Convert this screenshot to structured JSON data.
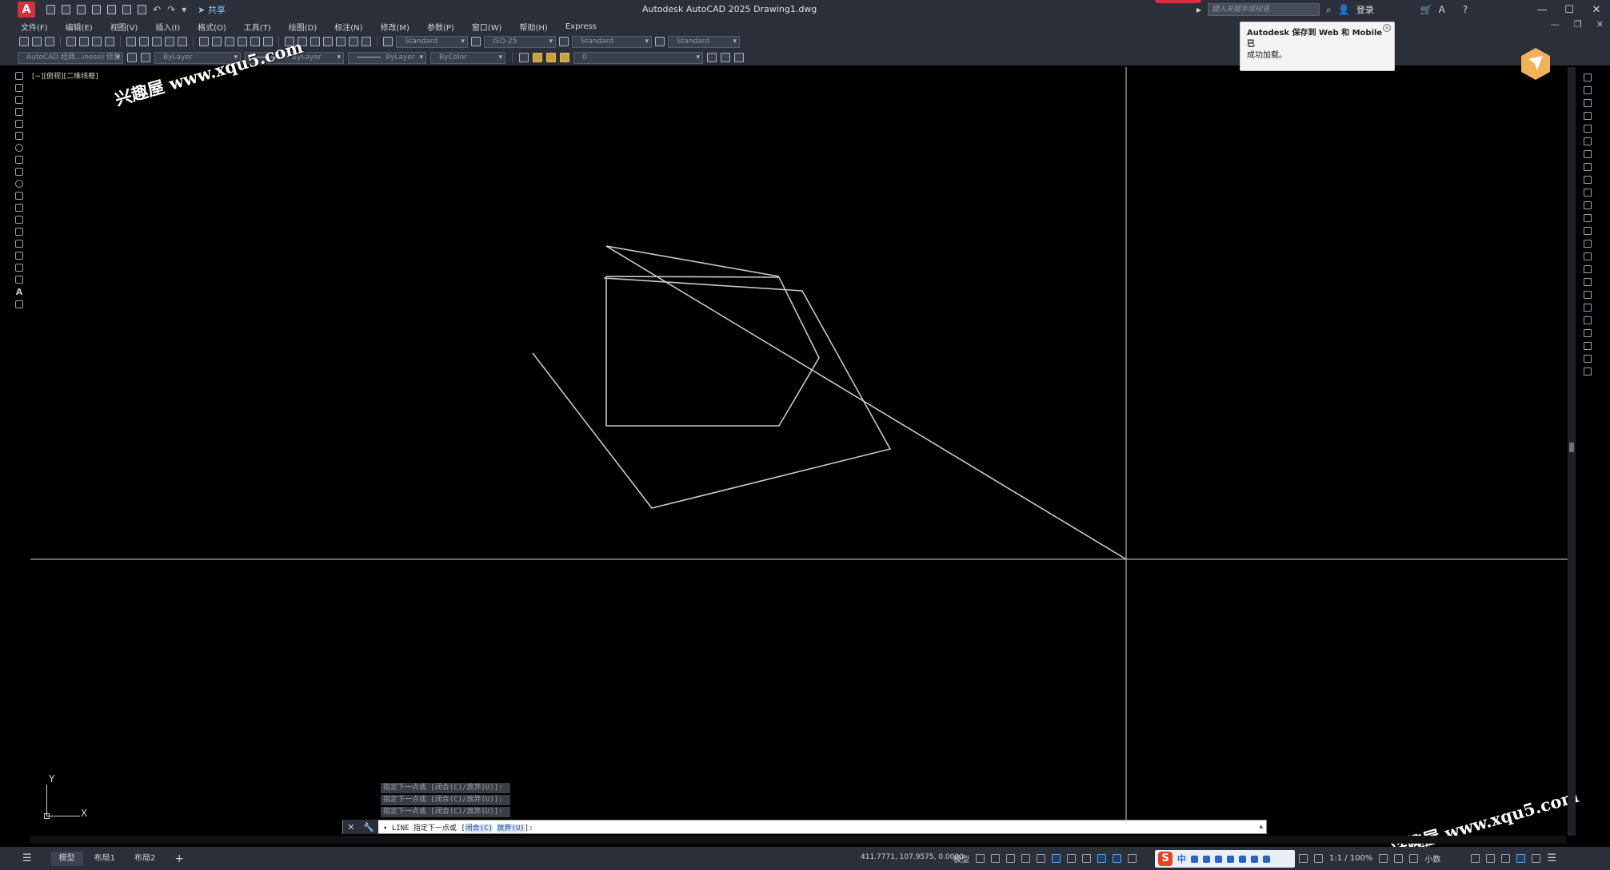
{
  "app": {
    "logo_letter": "A",
    "title": "Autodesk AutoCAD 2025    Drawing1.dwg",
    "share_label": "共享",
    "search_placeholder": "键入关键字或短语",
    "login_label": "登录",
    "window_controls": [
      "—",
      "☐",
      "✕"
    ],
    "doc_controls": [
      "—",
      "❐",
      "✕"
    ]
  },
  "menu": [
    "文件(F)",
    "编辑(E)",
    "视图(V)",
    "插入(I)",
    "格式(O)",
    "工具(T)",
    "绘图(D)",
    "标注(N)",
    "修改(M)",
    "参数(P)",
    "窗口(W)",
    "帮助(H)",
    "Express"
  ],
  "toolbar": {
    "text_style": "Standard",
    "dim_style": "ISO-25",
    "table_style": "Standard",
    "mleader_style": "Standard",
    "workspace": "AutoCAD 经典...inese) 修复",
    "layer_prop": "ByLayer",
    "linetype": "ByLayer",
    "lineweight": "ByLayer",
    "color": "ByColor",
    "layer_current": "0"
  },
  "viewport": {
    "label": "[−][俯视][二维线框]"
  },
  "watermark": {
    "text": "兴趣屋 www.xqu5.com"
  },
  "notification": {
    "line1": "Autodesk 保存到 Web 和 Mobile 已",
    "line2": "成功加载。"
  },
  "ucs": {
    "x": "X",
    "y": "Y"
  },
  "command": {
    "history": [
      "指定下一点或 [闭合(C)/放弃(U)]:",
      "指定下一点或 [闭合(C)/放弃(U)]:",
      "指定下一点或 [闭合(C)/放弃(U)]:"
    ],
    "prompt_prefix": "▾ LINE 指定下一点或 [",
    "option1": "闭合(C)",
    "option2": "放弃(U)",
    "prompt_suffix": "]:"
  },
  "status": {
    "tabs": [
      "模型",
      "布局1",
      "布局2"
    ],
    "add_tab": "+",
    "coords": "411.7771, 107.9575, 0.0000",
    "model_label": "模型",
    "scale": "1:1 / 100%",
    "units": "小数"
  },
  "ime": {
    "logo": "S",
    "mode": "中"
  },
  "colors": {
    "chrome": "#2b2f3a",
    "canvas": "#000000",
    "geometry": "#c8c8c8",
    "accent": "#d6303a"
  }
}
